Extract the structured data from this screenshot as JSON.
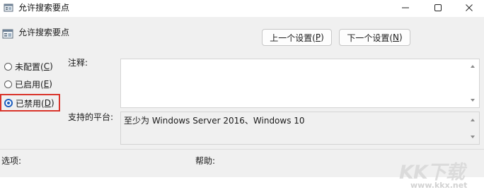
{
  "window": {
    "title": "允许搜索要点",
    "icons": {
      "app": "policy-icon",
      "minimize": "minimize-icon",
      "maximize": "maximize-icon",
      "close": "close-icon"
    }
  },
  "header": {
    "title": "允许搜索要点",
    "icon": "policy-setting-icon"
  },
  "nav": {
    "prev_text": "上一个设置(",
    "prev_key": "P",
    "prev_tail": ")",
    "next_text": "下一个设置(",
    "next_key": "N",
    "next_tail": ")"
  },
  "radios": [
    {
      "text": "未配置(",
      "key": "C",
      "tail": ")",
      "checked": false
    },
    {
      "text": "已启用(",
      "key": "E",
      "tail": ")",
      "checked": false
    },
    {
      "text": "已禁用(",
      "key": "D",
      "tail": ")",
      "checked": true
    }
  ],
  "labels": {
    "comment": "注释:",
    "platform": "支持的平台:",
    "options": "选项:",
    "help": "帮助:"
  },
  "comment_value": "",
  "platform_value": "至少为 Windows Server 2016、Windows 10",
  "watermark": {
    "brand": "KK下载",
    "url": "www.kkx.net"
  },
  "colors": {
    "selected_radio": "#1f5fbf",
    "highlight_box": "#d9342b",
    "panel_bg": "#f0f0f0"
  }
}
